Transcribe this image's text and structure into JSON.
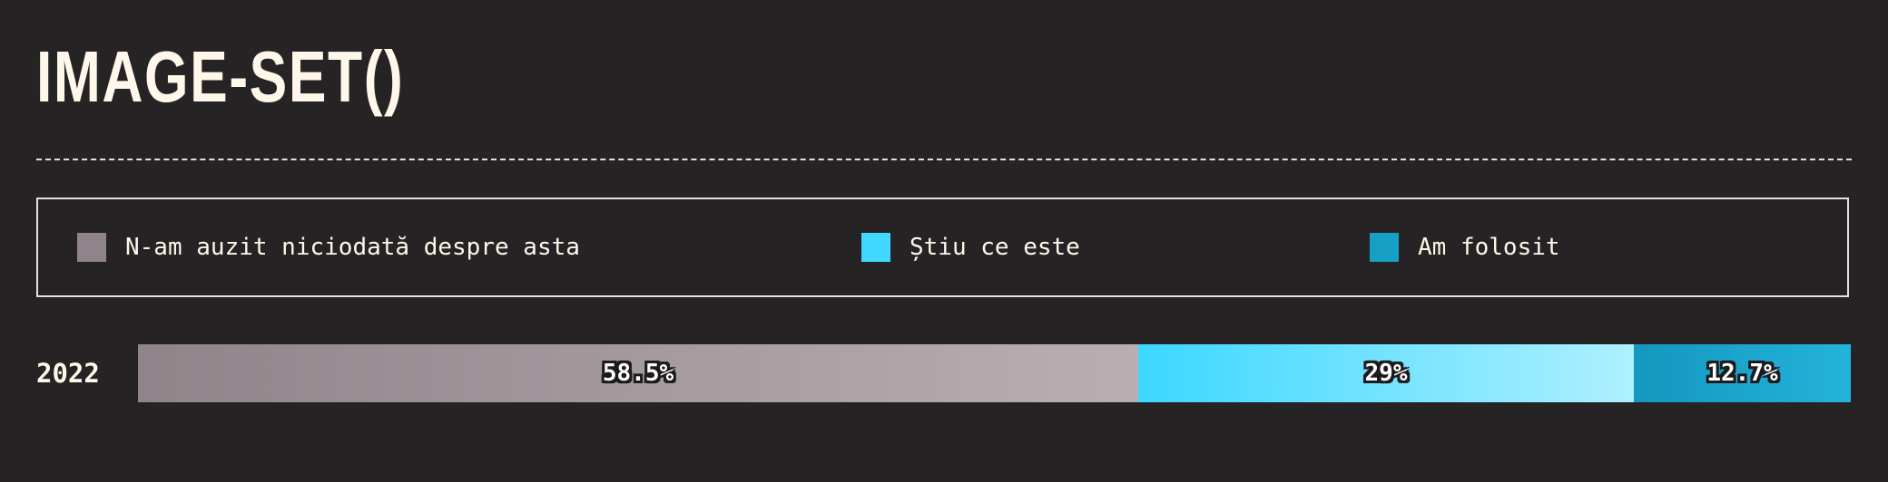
{
  "title": "IMAGE-SET()",
  "legend": [
    {
      "label": "N-am auzit niciodată despre asta",
      "color": "#8f8489"
    },
    {
      "label": "Știu ce este",
      "color": "#41d8ff"
    },
    {
      "label": "Am folosit",
      "color": "#179fc6"
    }
  ],
  "chart_data": {
    "type": "bar",
    "orientation": "horizontal",
    "stacked": true,
    "normalized_percent": true,
    "categories": [
      "2022"
    ],
    "series": [
      {
        "name": "N-am auzit niciodată despre asta",
        "values": [
          58.5
        ],
        "label": "58.5%",
        "color_from": "#8f8489",
        "color_to": "#b9afb3"
      },
      {
        "name": "Știu ce este",
        "values": [
          29
        ],
        "label": "29%",
        "color_from": "#3cd7ff",
        "color_to": "#aef0ff"
      },
      {
        "name": "Am folosit",
        "values": [
          12.7
        ],
        "label": "12.7%",
        "color_from": "#1497bf",
        "color_to": "#23b3db"
      }
    ],
    "xlim": [
      0,
      100.2
    ],
    "legend_position": "top",
    "grid": false
  }
}
